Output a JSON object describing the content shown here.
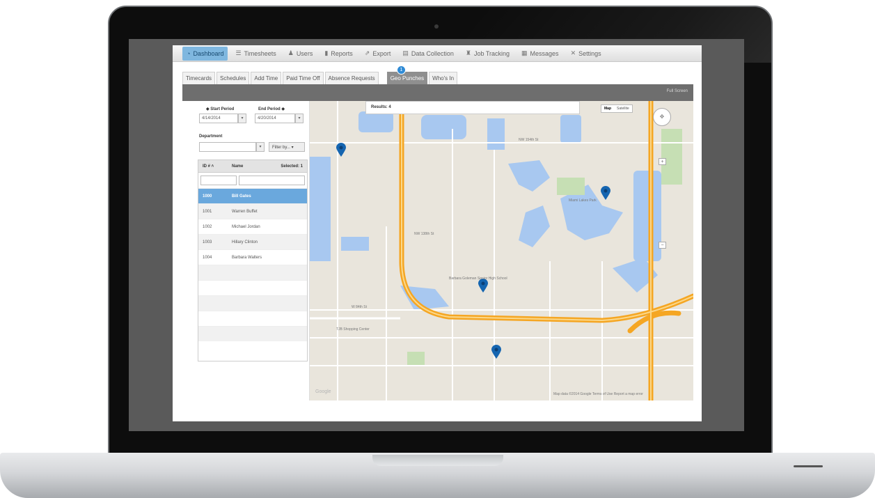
{
  "nav": {
    "items": [
      {
        "label": "Dashboard",
        "icon": "dashboard-icon",
        "glyph": "◔"
      },
      {
        "label": "Timesheets",
        "icon": "timesheets-icon",
        "glyph": "☰"
      },
      {
        "label": "Users",
        "icon": "users-icon",
        "glyph": "♟"
      },
      {
        "label": "Reports",
        "icon": "reports-icon",
        "glyph": "▮"
      },
      {
        "label": "Export",
        "icon": "export-icon",
        "glyph": "⇗"
      },
      {
        "label": "Data Collection",
        "icon": "data-collection-icon",
        "glyph": "▤"
      },
      {
        "label": "Job Tracking",
        "icon": "job-tracking-icon",
        "glyph": "♜"
      },
      {
        "label": "Messages",
        "icon": "messages-icon",
        "glyph": "▦"
      },
      {
        "label": "Settings",
        "icon": "settings-icon",
        "glyph": "✕"
      }
    ],
    "active_index": 0
  },
  "subtabs": {
    "items": [
      "Timecards",
      "Schedules",
      "Add Time",
      "Paid Time Off",
      "Absence Requests",
      "Geo Punches",
      "Who's In"
    ],
    "active": "Geo Punches",
    "badge": "1"
  },
  "toolbar": {
    "fullscreen_label": "Full Screen"
  },
  "filters": {
    "start_label": "Start Period",
    "end_label": "End Period",
    "start_value": "4/14/2014",
    "end_value": "4/20/2014",
    "department_label": "Department",
    "department_value": "",
    "filter_button": "Filter by..."
  },
  "table": {
    "headers": {
      "id": "ID #",
      "name": "Name",
      "selected": "Selected: 1"
    },
    "rows": [
      {
        "id": "1000",
        "name": "Bill Gates",
        "selected": true
      },
      {
        "id": "1001",
        "name": "Warren Buffet",
        "selected": false
      },
      {
        "id": "1002",
        "name": "Michael Jordan",
        "selected": false
      },
      {
        "id": "1003",
        "name": "Hillary Clinton",
        "selected": false
      },
      {
        "id": "1004",
        "name": "Barbara Walters",
        "selected": false
      }
    ]
  },
  "map": {
    "results": "Results: 4",
    "type_map": "Map",
    "type_satellite": "Satellite",
    "google_mark": "Google",
    "footer": "Map data ©2014 Google   Terms of Use   Report a map error",
    "labels": {
      "mall": "TJB Shopping Center",
      "school": "Barbara Goleman Senior High School",
      "park": "Miami Lakes Park",
      "st1": "NW 154th St",
      "st2": "NW 138th St",
      "st3": "W 84th St"
    },
    "pin_color": "#1565b0",
    "road_color": "#f5a623",
    "water_color": "#a8c8f0"
  }
}
